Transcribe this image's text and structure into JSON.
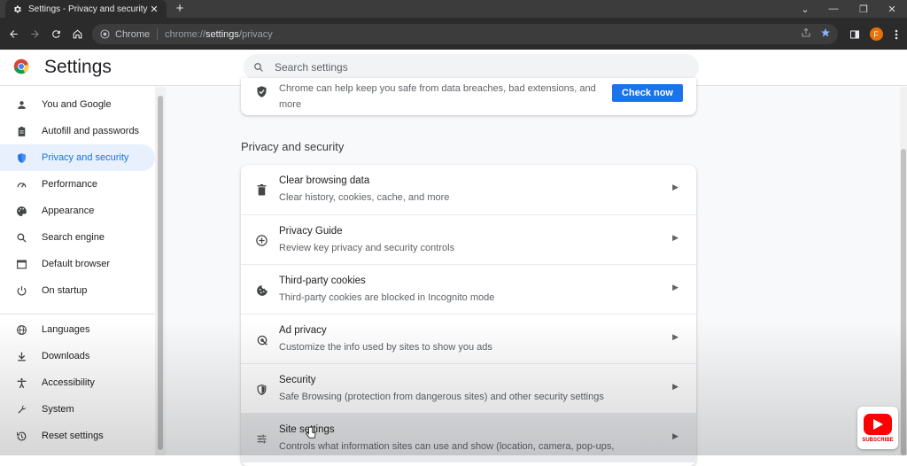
{
  "tab": {
    "title": "Settings - Privacy and security",
    "close": "✕",
    "new_tab": "+"
  },
  "window_controls": {
    "minimize": "—",
    "restore": "❐",
    "close": "✕",
    "chevron": "⌄"
  },
  "toolbar": {
    "back_icon": "arrow-left-icon",
    "forward_icon": "arrow-right-icon",
    "reload_icon": "reload-icon",
    "home_icon": "home-icon",
    "chip_label": "Chrome",
    "url_prefix": "chrome://",
    "url_bold": "settings",
    "url_suffix": "/privacy",
    "avatar_letter": "F"
  },
  "header": {
    "title": "Settings",
    "search_placeholder": "Search settings"
  },
  "sidebar": {
    "items": [
      {
        "label": "You and Google",
        "icon": "person-icon"
      },
      {
        "label": "Autofill and passwords",
        "icon": "clipboard-icon"
      },
      {
        "label": "Privacy and security",
        "icon": "shield-icon",
        "active": true
      },
      {
        "label": "Performance",
        "icon": "speedometer-icon"
      },
      {
        "label": "Appearance",
        "icon": "palette-icon"
      },
      {
        "label": "Search engine",
        "icon": "search-icon"
      },
      {
        "label": "Default browser",
        "icon": "browser-icon"
      },
      {
        "label": "On startup",
        "icon": "power-icon"
      },
      {
        "label": "Languages",
        "icon": "globe-icon"
      },
      {
        "label": "Downloads",
        "icon": "download-icon"
      },
      {
        "label": "Accessibility",
        "icon": "accessibility-icon"
      },
      {
        "label": "System",
        "icon": "wrench-icon"
      },
      {
        "label": "Reset settings",
        "icon": "history-icon"
      }
    ]
  },
  "safety_check": {
    "text": "Chrome can help keep you safe from data breaches, bad extensions, and more",
    "button": "Check now"
  },
  "privacy": {
    "section_title": "Privacy and security",
    "rows": [
      {
        "label": "Clear browsing data",
        "sub": "Clear history, cookies, cache, and more",
        "icon": "trash-icon"
      },
      {
        "label": "Privacy Guide",
        "sub": "Review key privacy and security controls",
        "icon": "plus-circle-icon"
      },
      {
        "label": "Third-party cookies",
        "sub": "Third-party cookies are blocked in Incognito mode",
        "icon": "cookie-icon"
      },
      {
        "label": "Ad privacy",
        "sub": "Customize the info used by sites to show you ads",
        "icon": "ad-privacy-icon"
      },
      {
        "label": "Security",
        "sub": "Safe Browsing (protection from dangerous sites) and other security settings",
        "icon": "shield-icon"
      },
      {
        "label": "Site settings",
        "sub": "Controls what information sites can use and show (location, camera, pop-ups,",
        "icon": "tune-icon"
      }
    ]
  },
  "subscribe": {
    "label": "SUBSCRIBE"
  },
  "colors": {
    "accent": "#1a73e8",
    "active_bg": "#e8f0fe",
    "toolbar_bg": "#2b2b2b",
    "subscribe_red": "#ff0000"
  }
}
